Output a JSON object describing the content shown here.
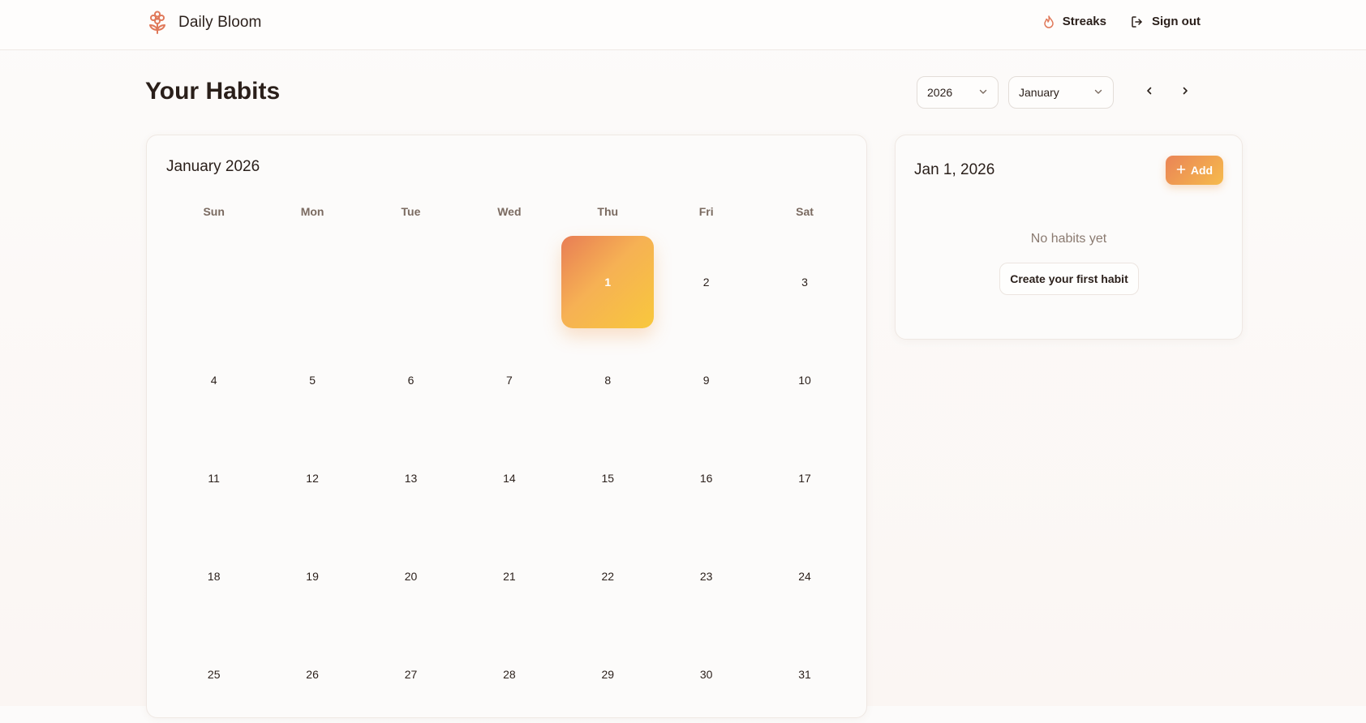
{
  "header": {
    "brand_name": "Daily Bloom",
    "nav": [
      {
        "label": "Streaks",
        "icon": "flame-icon"
      },
      {
        "label": "Sign out",
        "icon": "logout-icon"
      }
    ]
  },
  "page": {
    "title": "Your Habits"
  },
  "controls": {
    "year_selected": "2026",
    "month_selected": "January"
  },
  "calendar": {
    "title": "January 2026",
    "weekdays": [
      "Sun",
      "Mon",
      "Tue",
      "Wed",
      "Thu",
      "Fri",
      "Sat"
    ],
    "weeks": [
      [
        "",
        "",
        "",
        "",
        "1",
        "2",
        "3"
      ],
      [
        "4",
        "5",
        "6",
        "7",
        "8",
        "9",
        "10"
      ],
      [
        "11",
        "12",
        "13",
        "14",
        "15",
        "16",
        "17"
      ],
      [
        "18",
        "19",
        "20",
        "21",
        "22",
        "23",
        "24"
      ],
      [
        "25",
        "26",
        "27",
        "28",
        "29",
        "30",
        "31"
      ]
    ],
    "selected_day": "1"
  },
  "side_panel": {
    "date": "Jan 1, 2026",
    "add_label": "Add",
    "empty_text": "No habits yet",
    "create_label": "Create your first habit"
  },
  "colors": {
    "accent_start": "#e87d55",
    "accent_end": "#f8c83c",
    "text": "#2a1f1a",
    "muted": "#8a7a70"
  }
}
